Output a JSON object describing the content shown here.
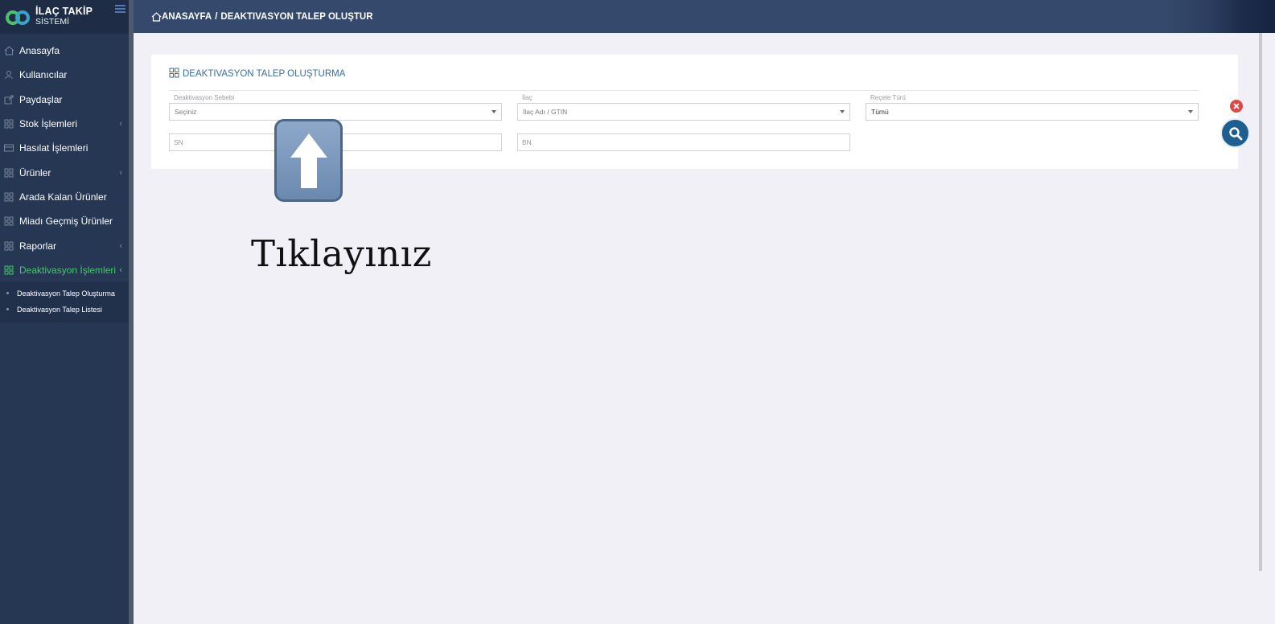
{
  "brand": {
    "title": "İLAÇ TAKİP",
    "subtitle": "SİSTEMİ"
  },
  "sidebar": {
    "items": [
      {
        "label": "Anasayfa",
        "icon": "home-icon",
        "has_chevron": false
      },
      {
        "label": "Kullanıcılar",
        "icon": "user-icon",
        "has_chevron": false
      },
      {
        "label": "Paydaşlar",
        "icon": "share-icon",
        "has_chevron": false
      },
      {
        "label": "Stok İşlemleri",
        "icon": "grid-icon",
        "has_chevron": true
      },
      {
        "label": "Hasılat İşlemleri",
        "icon": "card-icon",
        "has_chevron": false
      },
      {
        "label": "Ürünler",
        "icon": "grid-icon",
        "has_chevron": true
      },
      {
        "label": "Arada Kalan Ürünler",
        "icon": "grid-icon",
        "has_chevron": false
      },
      {
        "label": "Miadı Geçmiş Ürünler",
        "icon": "grid-icon",
        "has_chevron": false
      },
      {
        "label": "Raporlar",
        "icon": "grid-icon",
        "has_chevron": true
      },
      {
        "label": "Deaktivasyon İşlemleri",
        "icon": "grid-icon",
        "has_chevron": true,
        "active": true
      }
    ],
    "subitems": [
      {
        "label": "Deaktivasyon Talep Oluşturma"
      },
      {
        "label": "Deaktivasyon Talep Listesi"
      }
    ]
  },
  "header": {
    "breadcrumb_home": "ANASAYFA",
    "breadcrumb_sep": "/",
    "breadcrumb_current": "DEAKTIVASYON TALEP OLUŞTUR"
  },
  "panel": {
    "title": "DEAKTIVASYON TALEP OLUŞTURMA",
    "fields": {
      "reason": {
        "label": "Deaktivasyon Sebebi",
        "value": "Seçiniz"
      },
      "drug": {
        "label": "İlaç",
        "value": "İlaç Adı / GTIN"
      },
      "prescription": {
        "label": "Reçete Türü",
        "value": "Tümü"
      },
      "sn": {
        "placeholder": "SN"
      },
      "bn": {
        "placeholder": "BN"
      }
    }
  },
  "overlay": {
    "hint": "Tıklayınız"
  },
  "colors": {
    "sidebar_bg": "#263753",
    "header_bg": "#34496c",
    "active_green": "#42c86a",
    "search_button": "#1d5f91",
    "close_button": "#e04848"
  }
}
